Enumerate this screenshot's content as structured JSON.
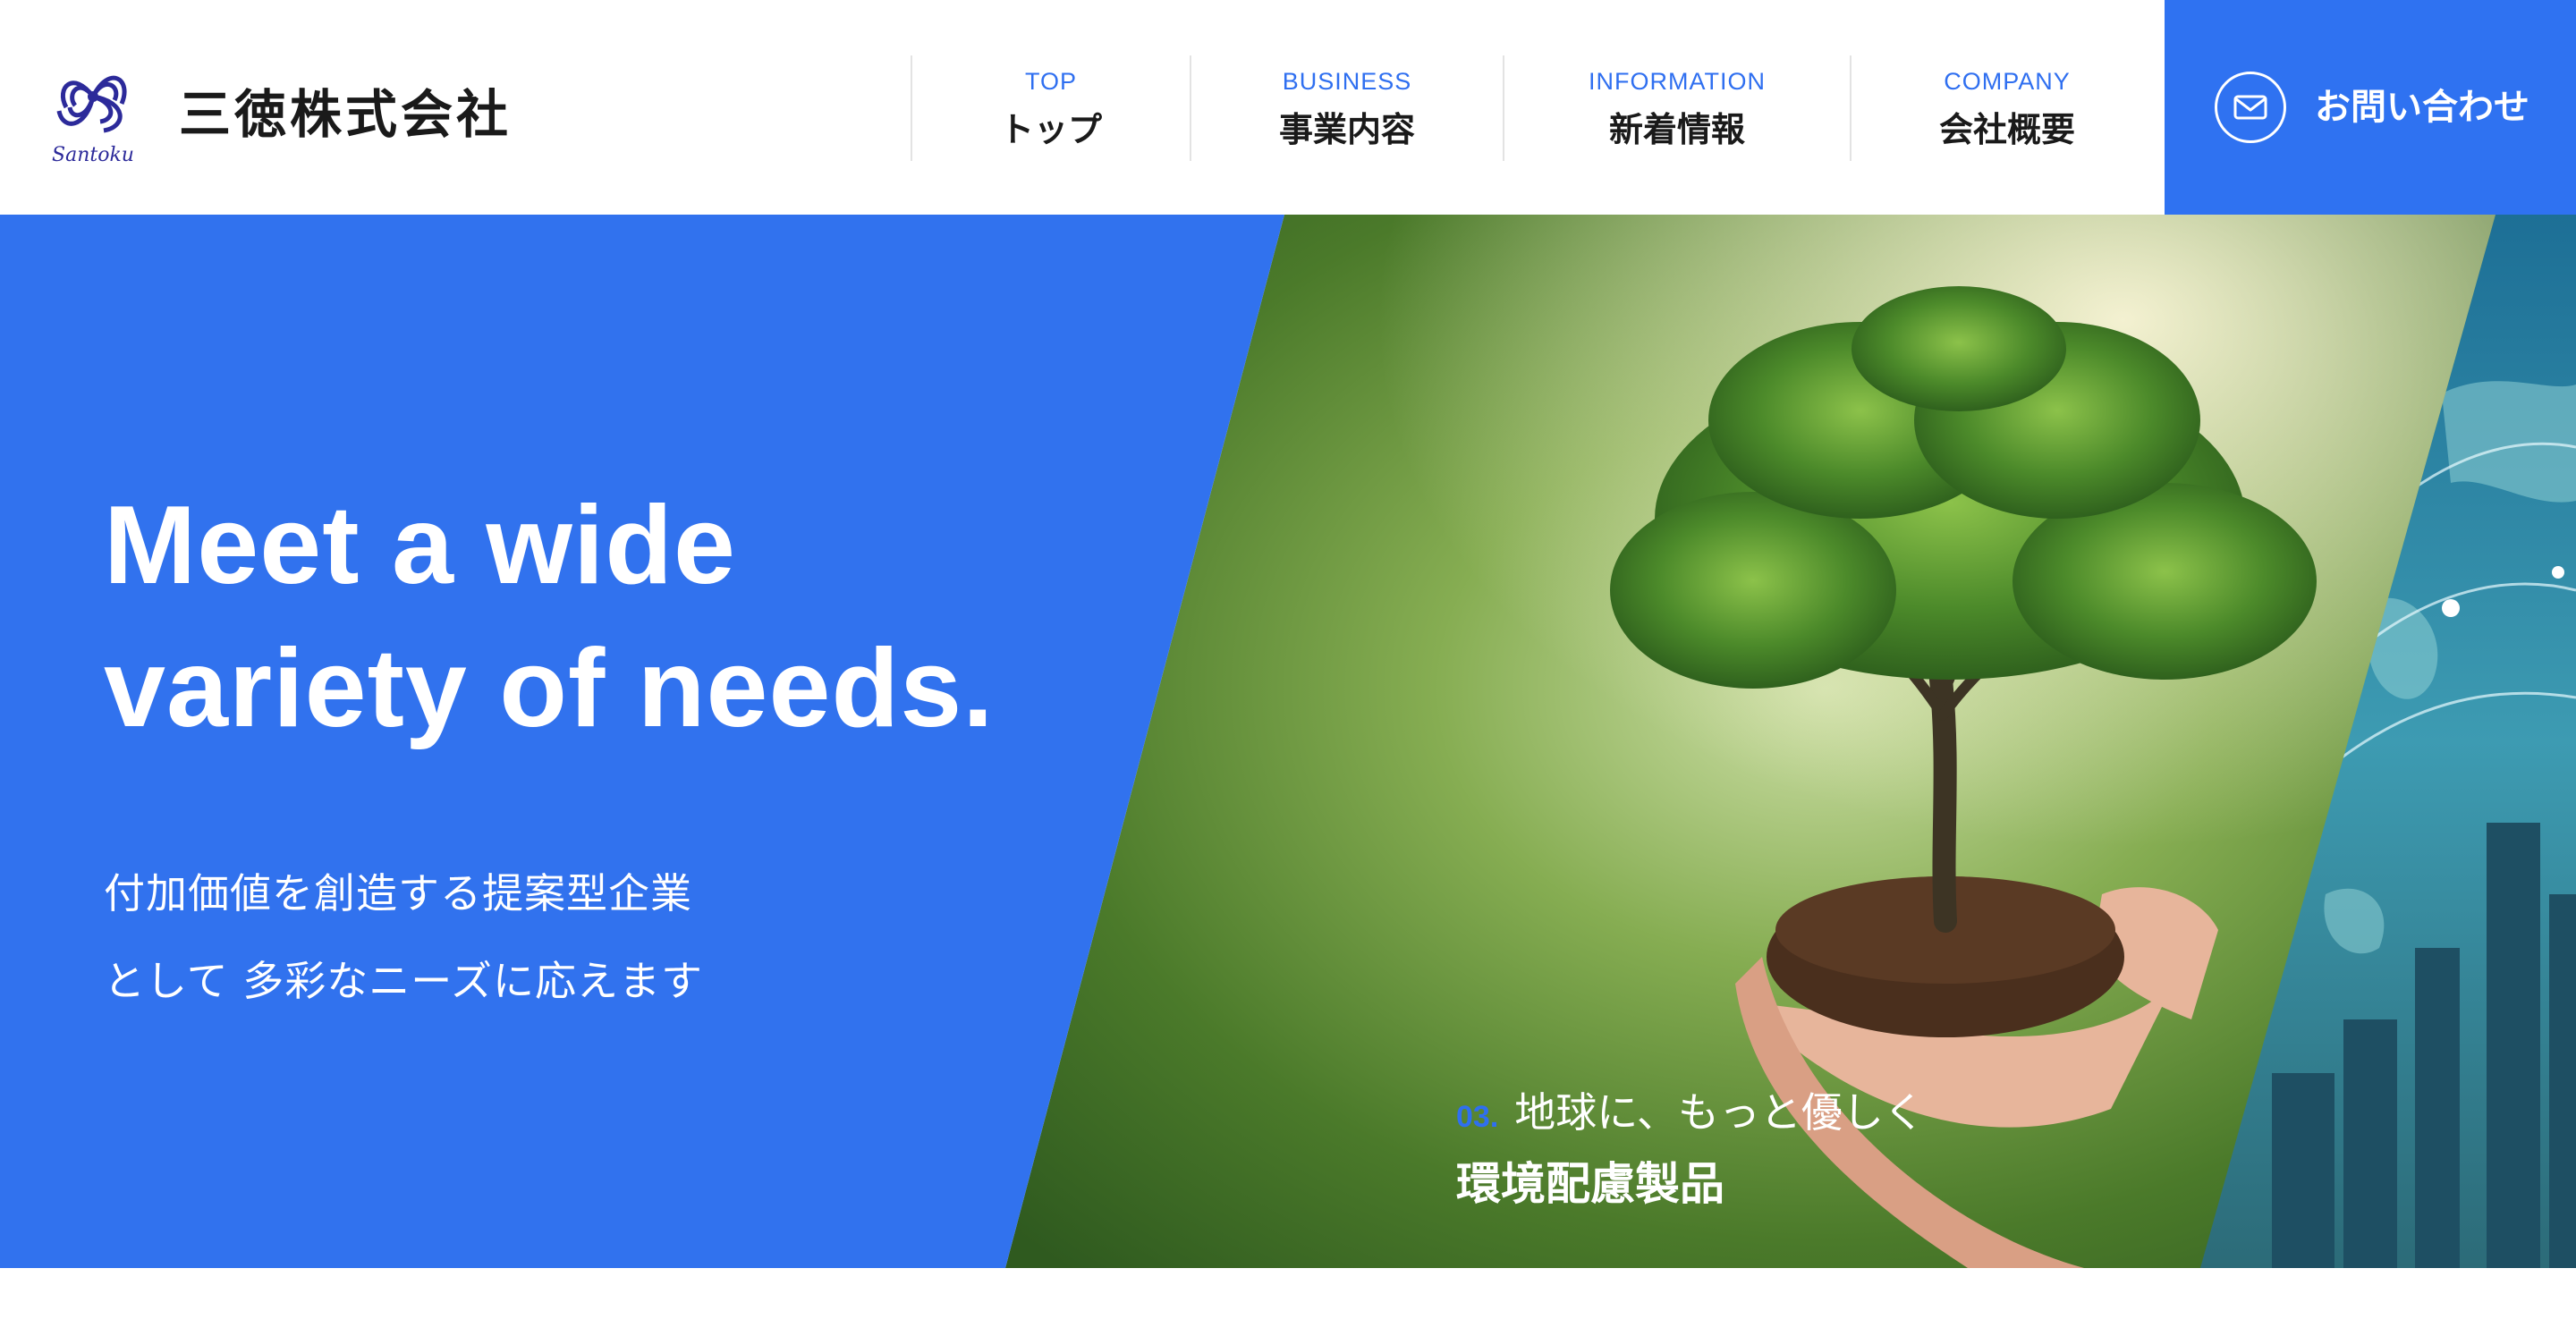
{
  "header": {
    "logo_wordmark": "Santoku",
    "company_name": "三徳株式会社",
    "nav": [
      {
        "en": "TOP",
        "ja": "トップ"
      },
      {
        "en": "BUSINESS",
        "ja": "事業内容"
      },
      {
        "en": "INFORMATION",
        "ja": "新着情報"
      },
      {
        "en": "COMPANY",
        "ja": "会社概要"
      }
    ],
    "contact": {
      "label": "お問い合わせ",
      "icon": "mail-icon"
    }
  },
  "hero": {
    "headline": [
      "Meet a wide",
      "variety of needs."
    ],
    "subcopy": [
      "付加価値を創造する提案型企業",
      "として 多彩なニーズに応えます"
    ],
    "slide": {
      "number": "03.",
      "tagline": "地球に、もっと優しく",
      "title": "環境配慮製品"
    }
  },
  "colors": {
    "accent": "#2f72f1",
    "hero_blue": "#3172ee",
    "text_dark": "#1a1a1a",
    "white": "#ffffff"
  }
}
